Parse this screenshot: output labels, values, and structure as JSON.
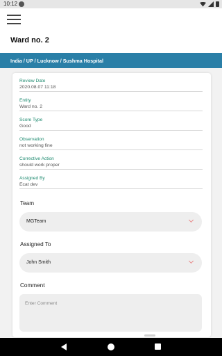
{
  "status_bar": {
    "time": "10:12"
  },
  "app_bar": {
    "title": "Ward no. 2"
  },
  "breadcrumb": {
    "path": "India / UP / Lucknow / Sushma Hospital"
  },
  "details": [
    {
      "label": "Review Date",
      "value": "2020.08.07 11:18"
    },
    {
      "label": "Entity",
      "value": "Ward no. 2"
    },
    {
      "label": "Score Type",
      "value": "Good"
    },
    {
      "label": "Observation",
      "value": "not working fine"
    },
    {
      "label": "Corrective Action",
      "value": "should work proper"
    },
    {
      "label": "Assigned By",
      "value": "Ecat dev"
    }
  ],
  "team": {
    "label": "Team",
    "selected": "MGTeam"
  },
  "assigned_to": {
    "label": "Assigned To",
    "selected": "John Smith"
  },
  "comment": {
    "label": "Comment",
    "placeholder": "Enter Comment",
    "value": ""
  },
  "icons": {
    "menu": "hamburger-menu-icon",
    "dropdown": "chevron-down-icon",
    "nav_back": "back-triangle-icon",
    "nav_home": "home-circle-icon",
    "nav_recent": "recent-apps-square-icon"
  },
  "colors": {
    "breadcrumb_bg": "#2a7fa7",
    "label_green": "#1d8a6f",
    "chevron": "#e88a8a"
  }
}
